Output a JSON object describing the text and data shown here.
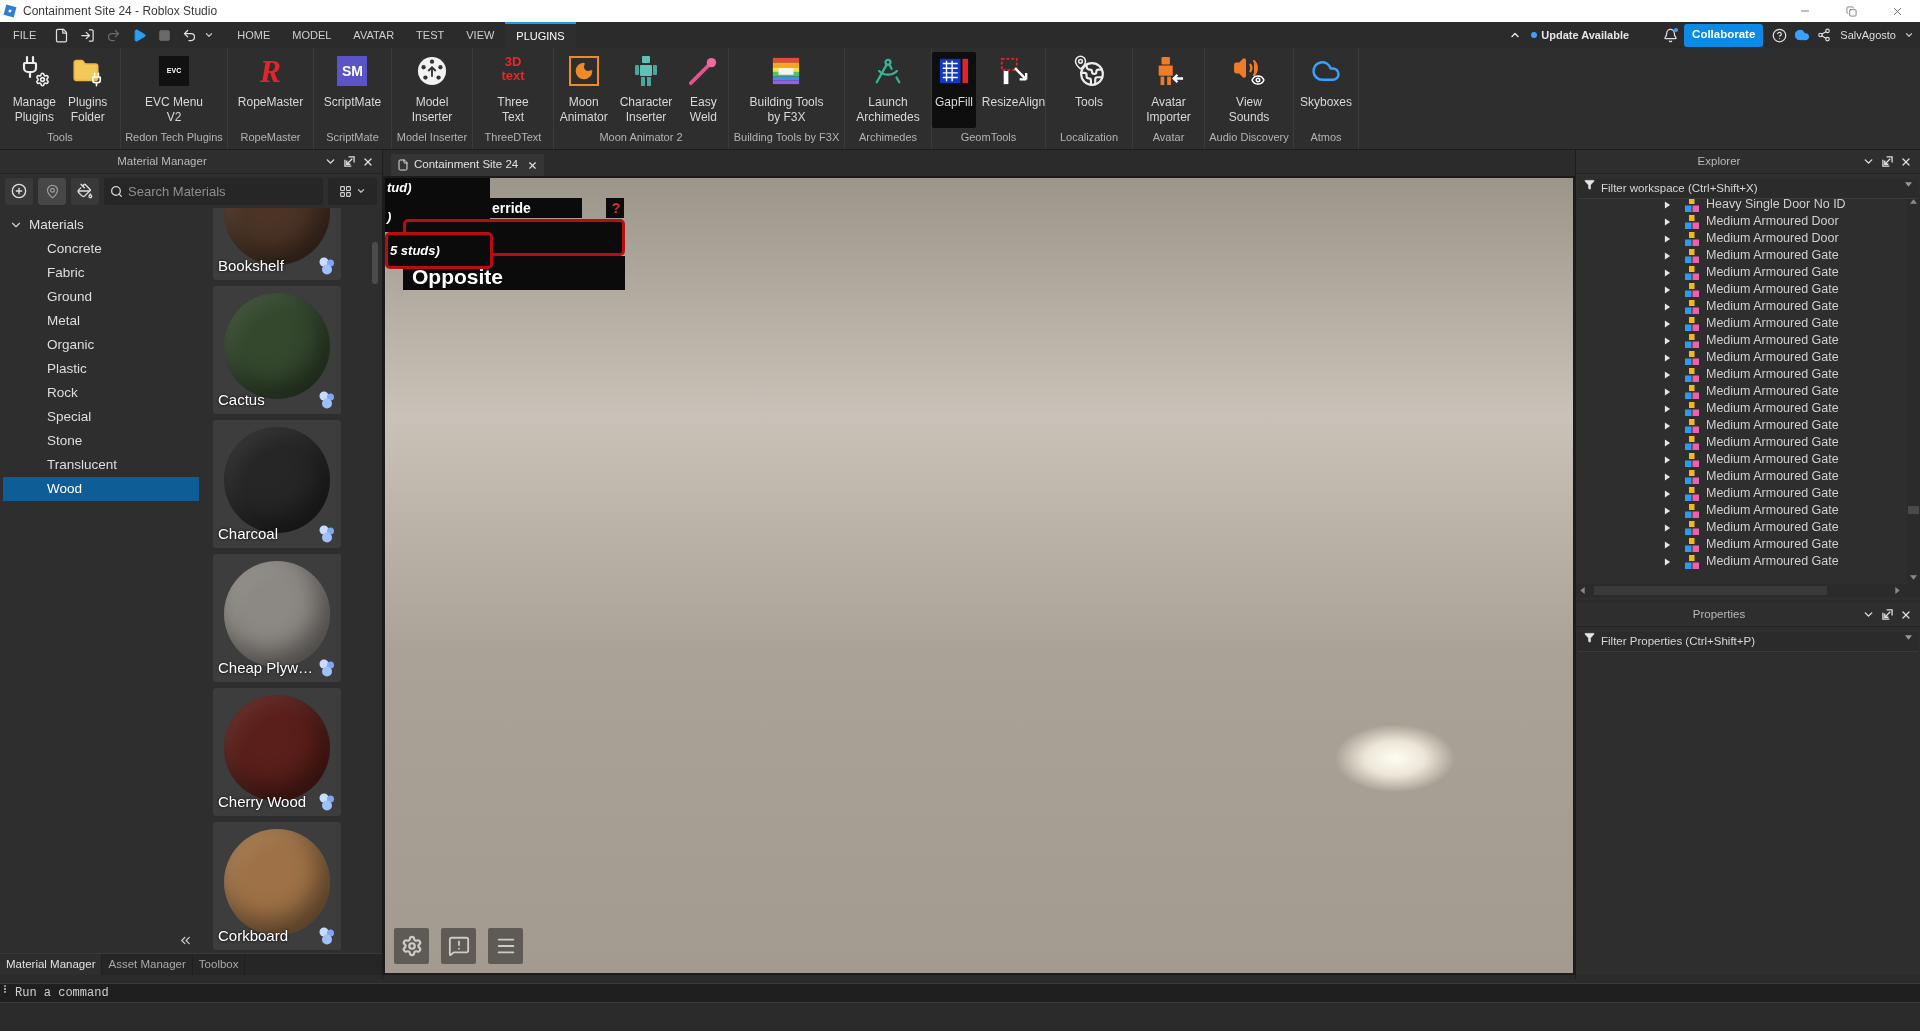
{
  "window": {
    "title": "Containment Site 24 - Roblox Studio"
  },
  "menu_bar": {
    "file": "FILE",
    "quick_access": [
      {
        "disabled": false
      },
      {
        "disabled": false
      },
      {
        "disabled": true
      },
      {
        "disabled": false
      },
      {
        "disabled": true
      },
      {
        "disabled": false
      }
    ],
    "tabs": [
      {
        "label": "HOME",
        "selected": false
      },
      {
        "label": "MODEL",
        "selected": false
      },
      {
        "label": "AVATAR",
        "selected": false
      },
      {
        "label": "TEST",
        "selected": false
      },
      {
        "label": "VIEW",
        "selected": false
      },
      {
        "label": "PLUGINS",
        "selected": true
      }
    ],
    "update_notice": "Update Available",
    "collaborate": "Collaborate",
    "user": "SalvAgosto"
  },
  "ribbon": [
    {
      "group": "Tools",
      "buttons": [
        {
          "label": "Manage\nPlugins",
          "active": false
        },
        {
          "label": "Plugins\nFolder",
          "active": false
        }
      ]
    },
    {
      "group": "Redon Tech Plugins",
      "buttons": [
        {
          "label": "EVC Menu\nV2",
          "logo": "EVC",
          "active": false
        }
      ]
    },
    {
      "group": "RopeMaster",
      "buttons": [
        {
          "label": "RopeMaster",
          "logo": "R",
          "active": false
        }
      ]
    },
    {
      "group": "ScriptMate",
      "buttons": [
        {
          "label": "ScriptMate",
          "logo": "SM",
          "active": false
        }
      ]
    },
    {
      "group": "Model Inserter",
      "buttons": [
        {
          "label": "Model\nInserter",
          "active": false
        }
      ]
    },
    {
      "group": "ThreeDText",
      "buttons": [
        {
          "label": "Three\nText",
          "logo": "3D\ntext",
          "active": false
        }
      ]
    },
    {
      "group": "Moon Animator 2",
      "buttons": [
        {
          "label": "Moon\nAnimator",
          "active": false
        },
        {
          "label": "Character\nInserter",
          "active": false
        },
        {
          "label": "Easy\nWeld",
          "active": false
        }
      ]
    },
    {
      "group": "Building Tools by F3X",
      "buttons": [
        {
          "label": "Building Tools\nby F3X",
          "active": false
        }
      ]
    },
    {
      "group": "Archimedes",
      "buttons": [
        {
          "label": "Launch\nArchimedes",
          "active": false
        }
      ]
    },
    {
      "group": "GeomTools",
      "buttons": [
        {
          "label": "GapFill",
          "active": true
        },
        {
          "label": "ResizeAlign",
          "active": false
        }
      ]
    },
    {
      "group": "Localization",
      "buttons": [
        {
          "label": "Tools",
          "active": false
        }
      ]
    },
    {
      "group": "Avatar",
      "buttons": [
        {
          "label": "Avatar\nImporter",
          "active": false
        }
      ]
    },
    {
      "group": "Audio Discovery",
      "buttons": [
        {
          "label": "View\nSounds",
          "active": false
        }
      ]
    },
    {
      "group": "Atmos",
      "buttons": [
        {
          "label": "Skyboxes",
          "active": false
        }
      ]
    }
  ],
  "material_manager": {
    "title": "Material Manager",
    "search": {
      "placeholder": "Search Materials"
    },
    "tree": {
      "label": "Materials",
      "expanded": true,
      "children": [
        {
          "label": "Concrete",
          "selected": false
        },
        {
          "label": "Fabric",
          "selected": false
        },
        {
          "label": "Ground",
          "selected": false
        },
        {
          "label": "Metal",
          "selected": false
        },
        {
          "label": "Organic",
          "selected": false
        },
        {
          "label": "Plastic",
          "selected": false
        },
        {
          "label": "Rock",
          "selected": false
        },
        {
          "label": "Special",
          "selected": false
        },
        {
          "label": "Stone",
          "selected": false
        },
        {
          "label": "Translucent",
          "selected": false
        },
        {
          "label": "Wood",
          "selected": true
        }
      ]
    },
    "materials": [
      {
        "name": "Bookshelf",
        "color": "#4b3426"
      },
      {
        "name": "Cactus",
        "color": "#34482e"
      },
      {
        "name": "Charcoal",
        "color": "#262626"
      },
      {
        "name": "Cheap Plyw…",
        "color": "#8c8883"
      },
      {
        "name": "Cherry Wood",
        "color": "#5a1f1a"
      },
      {
        "name": "Corkboard",
        "color": "#9e7246"
      }
    ],
    "tabs": [
      {
        "label": "Material Manager",
        "selected": true
      },
      {
        "label": "Asset Manager",
        "selected": false
      },
      {
        "label": "Toolbox",
        "selected": false
      }
    ]
  },
  "viewport": {
    "tab": "Containment Site 24",
    "overlay": [
      {
        "text": "tud)",
        "kind": "dark"
      },
      {
        "text": ")",
        "kind": "dark"
      },
      {
        "text": "erride",
        "kind": "dark"
      },
      {
        "text": "?",
        "kind": "help"
      },
      {
        "text": "Opposite",
        "kind": "dark"
      },
      {
        "text": "5 studs)",
        "kind": "outlined"
      }
    ]
  },
  "explorer": {
    "title": "Explorer",
    "filter": {
      "placeholder": "Filter workspace (Ctrl+Shift+X)"
    },
    "rows": [
      {
        "label": "Heavy Single Door No ID",
        "expanded": false
      },
      {
        "label": "Medium Armoured Door",
        "expanded": false
      },
      {
        "label": "Medium Armoured Door",
        "expanded": false
      },
      {
        "label": "Medium Armoured Gate",
        "expanded": false
      },
      {
        "label": "Medium Armoured Gate",
        "expanded": false
      },
      {
        "label": "Medium Armoured Gate",
        "expanded": false
      },
      {
        "label": "Medium Armoured Gate",
        "expanded": false
      },
      {
        "label": "Medium Armoured Gate",
        "expanded": false
      },
      {
        "label": "Medium Armoured Gate",
        "expanded": false
      },
      {
        "label": "Medium Armoured Gate",
        "expanded": false
      },
      {
        "label": "Medium Armoured Gate",
        "expanded": false
      },
      {
        "label": "Medium Armoured Gate",
        "expanded": false
      },
      {
        "label": "Medium Armoured Gate",
        "expanded": false
      },
      {
        "label": "Medium Armoured Gate",
        "expanded": false
      },
      {
        "label": "Medium Armoured Gate",
        "expanded": false
      },
      {
        "label": "Medium Armoured Gate",
        "expanded": false
      },
      {
        "label": "Medium Armoured Gate",
        "expanded": false
      },
      {
        "label": "Medium Armoured Gate",
        "expanded": false
      },
      {
        "label": "Medium Armoured Gate",
        "expanded": false
      },
      {
        "label": "Medium Armoured Gate",
        "expanded": false
      },
      {
        "label": "Medium Armoured Gate",
        "expanded": false
      },
      {
        "label": "Medium Armoured Gate",
        "expanded": false
      }
    ]
  },
  "properties": {
    "title": "Properties",
    "filter": {
      "placeholder": "Filter Properties (Ctrl+Shift+P)"
    }
  },
  "command_bar": {
    "placeholder": "Run a command"
  }
}
